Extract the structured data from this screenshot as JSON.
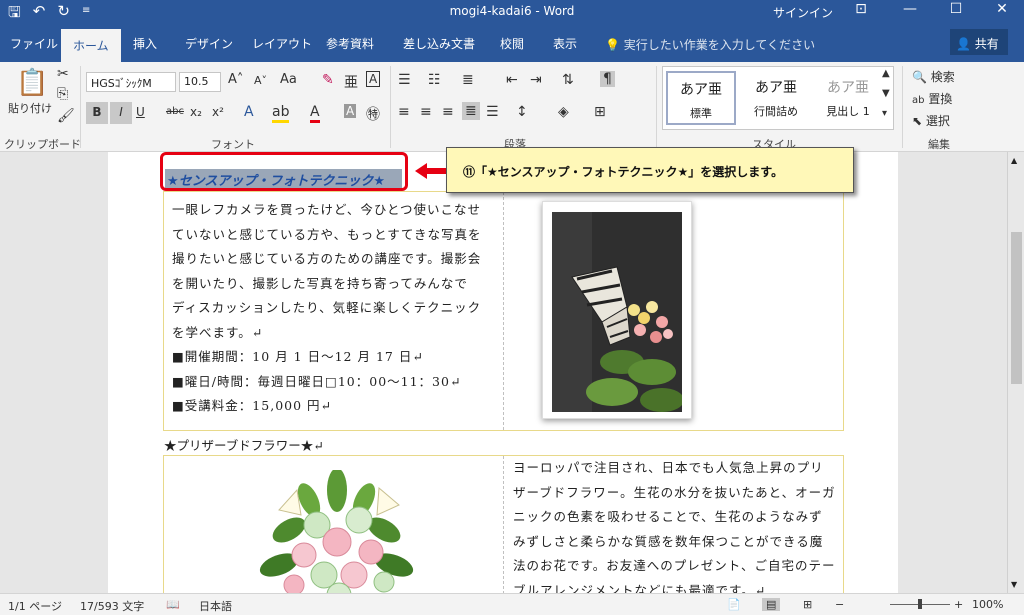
{
  "titlebar": {
    "title": "mogi4-kadai6  -  Word",
    "signin": "サインイン",
    "qat": [
      "save-icon",
      "undo-icon",
      "redo-icon",
      "customize-icon"
    ]
  },
  "tabs": {
    "items": [
      "ファイル",
      "ホーム",
      "挿入",
      "デザイン",
      "レイアウト",
      "参考資料",
      "差し込み文書",
      "校閲",
      "表示"
    ],
    "active": "ホーム",
    "tell_me": "実行したい作業を入力してください",
    "share": "共有"
  },
  "ribbon": {
    "clipboard": {
      "paste_label": "貼り付け",
      "group_label": "クリップボード"
    },
    "font": {
      "font_name": "HGSｺﾞｼｯｸM",
      "font_size": "10.5",
      "group_label": "フォント",
      "buttons": [
        "B",
        "I",
        "U",
        "abc",
        "x₂",
        "x²"
      ]
    },
    "paragraph": {
      "group_label": "段落"
    },
    "styles": {
      "group_label": "スタイル",
      "items": [
        {
          "sample": "あア亜",
          "name": "標準"
        },
        {
          "sample": "あア亜",
          "name": "行間詰め"
        },
        {
          "sample": "あア亜",
          "name": "見出し 1"
        }
      ]
    },
    "editing": {
      "group_label": "編集",
      "find": "検索",
      "replace": "置換",
      "select": "選択"
    }
  },
  "document": {
    "heading1": "★センスアップ・フォトテクニック★",
    "body1": [
      "一眼レフカメラを買ったけど、今ひとつ使いこなせ",
      "ていないと感じている方や、もっとすてきな写真を",
      "撮りたいと感じている方のための講座です。撮影会",
      "を開いたり、撮影した写真を持ち寄ってみんなで",
      "ディスカッションしたり、気軽に楽しくテクニック",
      "を学べます。↵",
      "■開催期間：10 月 1 日～12 月 17 日↵",
      "■曜日/時間：毎週日曜日□10：00～11：30↵",
      "■受講料金：15,000 円↵"
    ],
    "heading2": "★プリザーブドフラワー★↵",
    "body2": [
      "ヨーロッパで注目され、日本でも人気急上昇のプリ",
      "ザーブドフラワー。生花の水分を抜いたあと、オーガ",
      "ニックの色素を吸わせることで、生花のようなみず",
      "みずしさと柔らかな質感を数年保つことができる魔",
      "法のお花です。お友達へのプレゼント、ご自宅のテー",
      "ブルアレンジメントなどにも最適です。↵"
    ]
  },
  "callout": {
    "text": "⑪「★センスアップ・フォトテクニック★」を選択します。"
  },
  "statusbar": {
    "page": "1/1 ページ",
    "words": "17/593 文字",
    "language": "日本語",
    "zoom": "100%"
  },
  "colors": {
    "word_blue": "#2b579a",
    "highlight_red": "#e60012",
    "callout_bg": "#fff8b8",
    "selection_gray": "#9aa7b8"
  }
}
